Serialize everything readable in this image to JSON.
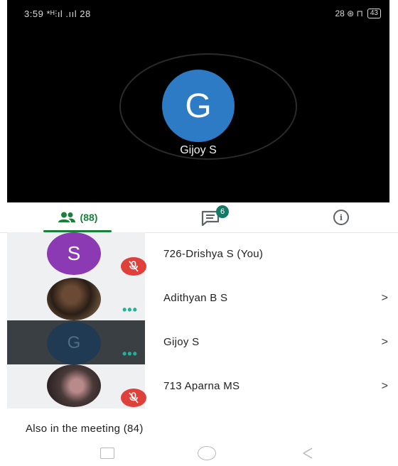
{
  "status_bar": {
    "time": "3:59",
    "left_icons": "*ᴴ⫶ıl .ııl 28",
    "right_icons": "28 ⊛ ⊓",
    "battery": "43"
  },
  "speaker": {
    "initial": "G",
    "name": "Gijoy S"
  },
  "tabs": {
    "people_count": "(88)",
    "chat_badge": "6"
  },
  "participants": [
    {
      "initial": "S",
      "name": "726-Drishya S (You)",
      "muted": true,
      "chevron": ""
    },
    {
      "initial": "",
      "name": "Adithyan B S",
      "muted": false,
      "chevron": ">"
    },
    {
      "initial": "G",
      "name": "Gijoy S",
      "muted": false,
      "chevron": ">"
    },
    {
      "initial": "",
      "name": "713 Aparna MS",
      "muted": true,
      "chevron": ">"
    }
  ],
  "also_in_meeting": "Also in the meeting (84)",
  "more_indicator": "•••",
  "colors": {
    "accent_green": "#188038",
    "badge_teal": "#137a68",
    "mute_red": "#e0403a",
    "speaker_blue": "#2d7bc5"
  }
}
